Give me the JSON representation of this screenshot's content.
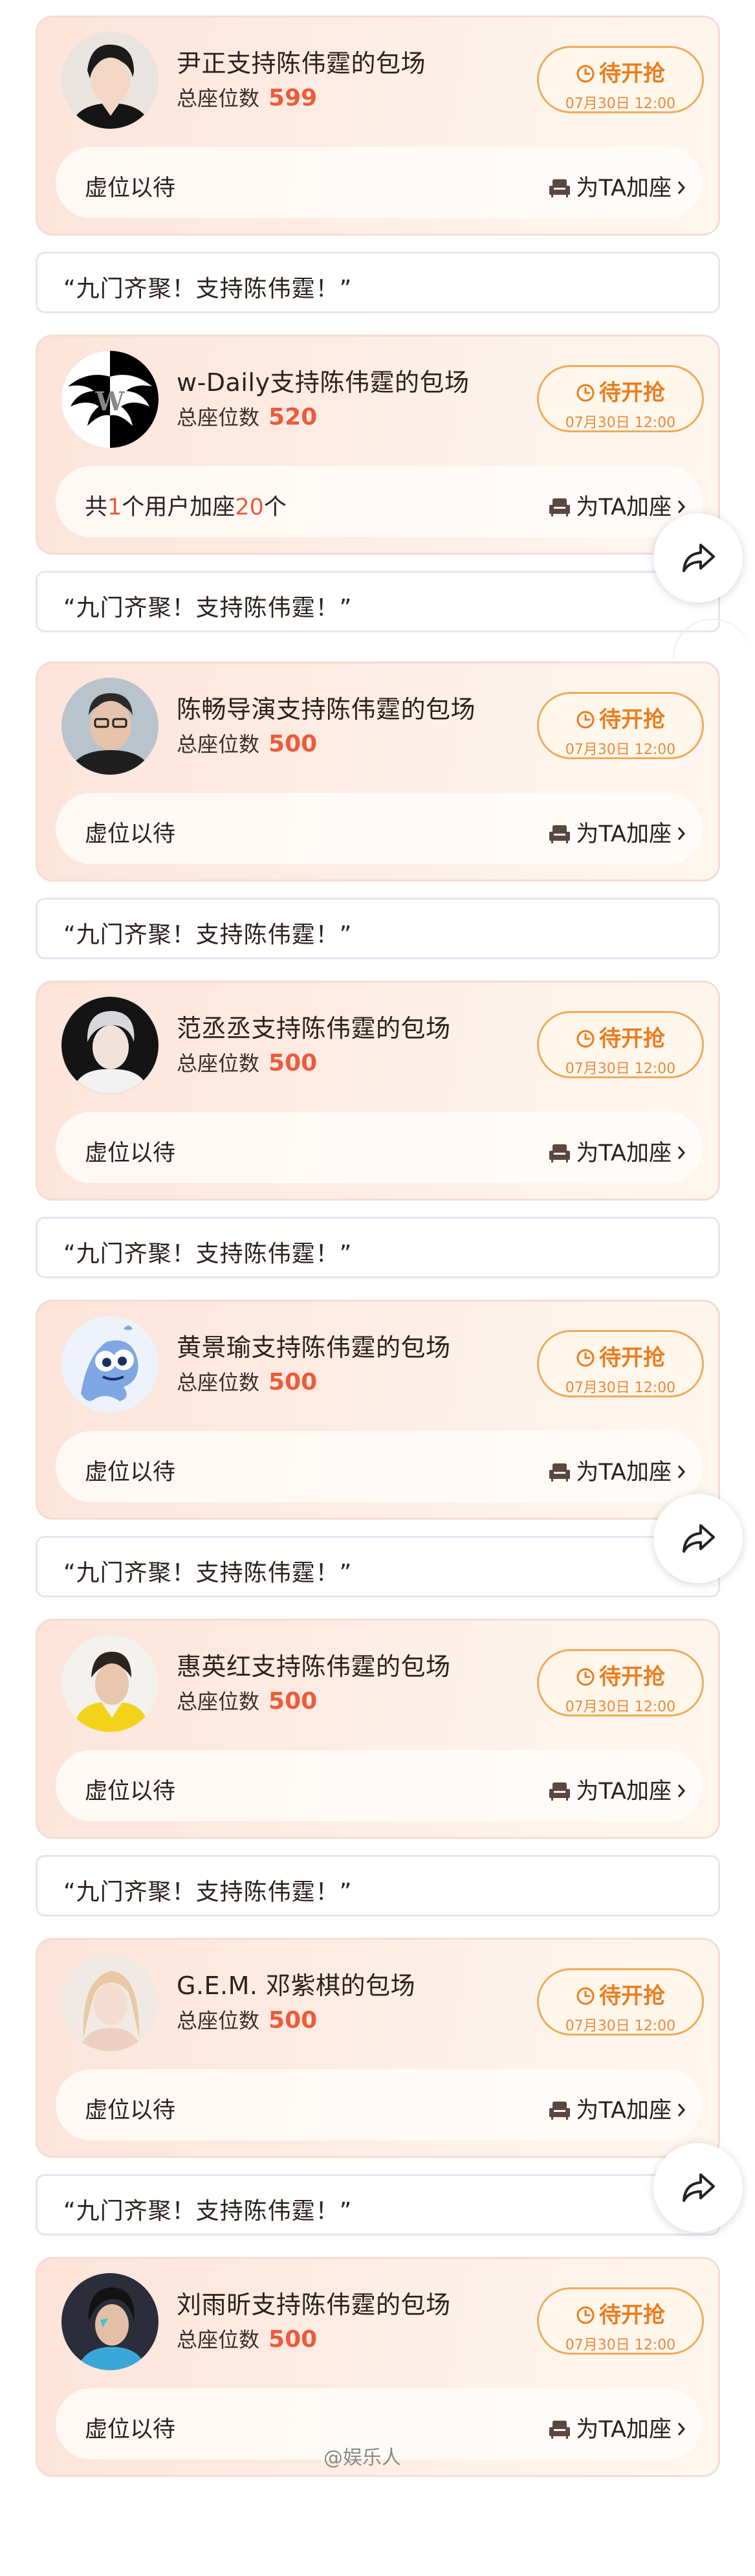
{
  "cards": [
    {
      "title": "尹正支持陈伟霆的包场",
      "seats_label": "总座位数",
      "seats": "599",
      "status_label": "待开抢",
      "time": "07月30日 12:00",
      "bar_text": "虚位以待",
      "add_label": "为TA加座",
      "message": "“九门齐聚！支持陈伟霆！”"
    },
    {
      "title": "w-Daily支持陈伟霆的包场",
      "seats_label": "总座位数",
      "seats": "520",
      "status_label": "待开抢",
      "time": "07月30日 12:00",
      "bar_parts": [
        "共",
        "1",
        "个用户加座",
        "20",
        "个"
      ],
      "add_label": "为TA加座",
      "message": "“九门齐聚！支持陈伟霆！”"
    },
    {
      "title": "陈畅导演支持陈伟霆的包场",
      "seats_label": "总座位数",
      "seats": "500",
      "status_label": "待开抢",
      "time": "07月30日 12:00",
      "bar_text": "虚位以待",
      "add_label": "为TA加座",
      "message": "“九门齐聚！支持陈伟霆！”"
    },
    {
      "title": "范丞丞支持陈伟霆的包场",
      "seats_label": "总座位数",
      "seats": "500",
      "status_label": "待开抢",
      "time": "07月30日 12:00",
      "bar_text": "虚位以待",
      "add_label": "为TA加座",
      "message": "“九门齐聚！支持陈伟霆！”"
    },
    {
      "title": "黄景瑜支持陈伟霆的包场",
      "seats_label": "总座位数",
      "seats": "500",
      "status_label": "待开抢",
      "time": "07月30日 12:00",
      "bar_text": "虚位以待",
      "add_label": "为TA加座",
      "message": "“九门齐聚！支持陈伟霆！”"
    },
    {
      "title": "惠英红支持陈伟霆的包场",
      "seats_label": "总座位数",
      "seats": "500",
      "status_label": "待开抢",
      "time": "07月30日 12:00",
      "bar_text": "虚位以待",
      "add_label": "为TA加座",
      "message": "“九门齐聚！支持陈伟霆！”"
    },
    {
      "title": "G.E.M. 邓紫棋的包场",
      "seats_label": "总座位数",
      "seats": "500",
      "status_label": "待开抢",
      "time": "07月30日 12:00",
      "bar_text": "虚位以待",
      "add_label": "为TA加座",
      "message": "“九门齐聚！支持陈伟霆！”"
    },
    {
      "title": "刘雨昕支持陈伟霆的包场",
      "seats_label": "总座位数",
      "seats": "500",
      "status_label": "待开抢",
      "time": "07月30日 12:00",
      "bar_text": "虚位以待",
      "add_label": "为TA加座",
      "message": ""
    }
  ],
  "share_icon": "share-arrow-icon",
  "watermark": "@娱乐人",
  "colors": {
    "accent": "#ef5a3a",
    "status": "#ec7d1e",
    "card_bg": "#fde4da"
  }
}
